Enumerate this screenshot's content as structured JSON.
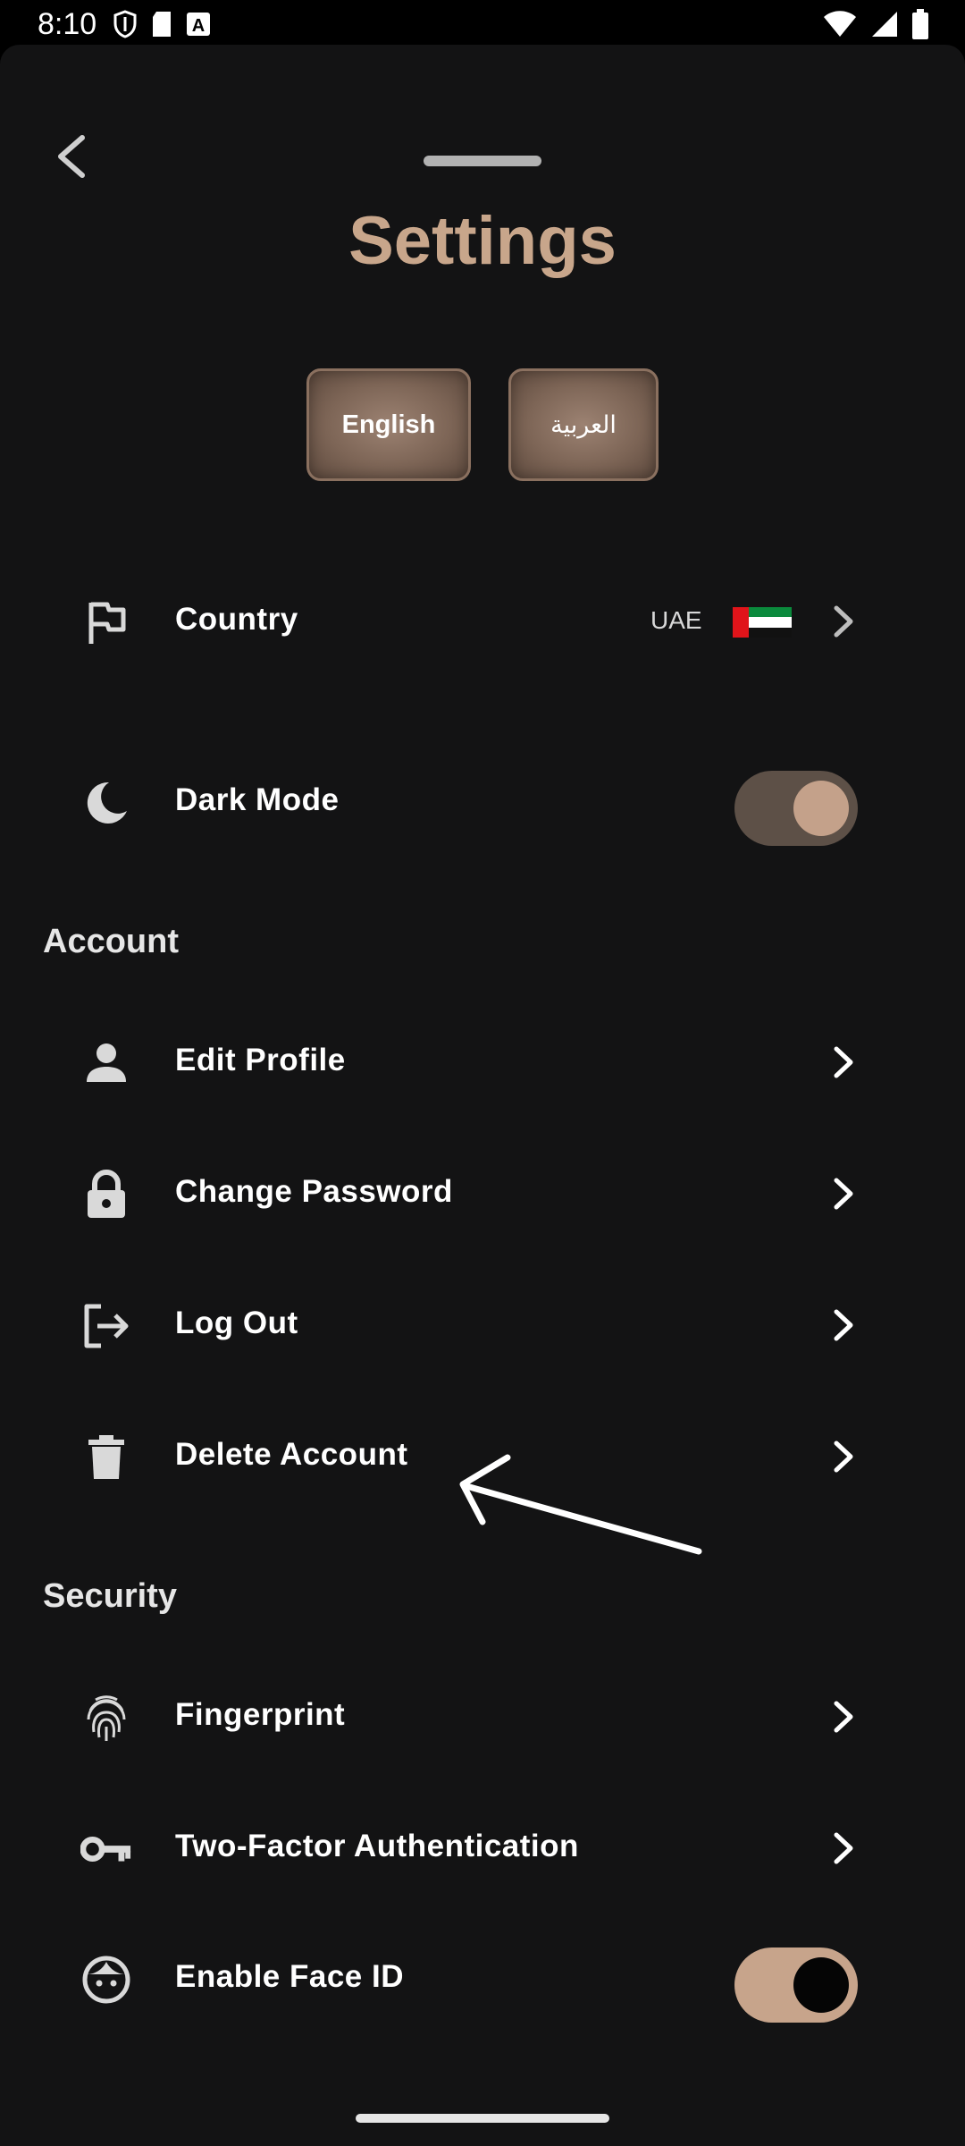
{
  "status_bar": {
    "time": "8:10"
  },
  "header": {
    "title": "Settings"
  },
  "language": {
    "english_label": "English",
    "arabic_label": "العربية"
  },
  "general": {
    "country": {
      "label": "Country",
      "value": "UAE"
    },
    "dark_mode": {
      "label": "Dark Mode",
      "enabled": true
    }
  },
  "account": {
    "header": "Account",
    "items": [
      {
        "label": "Edit Profile",
        "icon": "person-icon"
      },
      {
        "label": "Change Password",
        "icon": "lock-icon"
      },
      {
        "label": "Log Out",
        "icon": "logout-icon"
      },
      {
        "label": "Delete Account",
        "icon": "trash-icon"
      }
    ]
  },
  "security": {
    "header": "Security",
    "items": [
      {
        "label": "Fingerprint",
        "icon": "fingerprint-icon"
      },
      {
        "label": "Two-Factor Authentication",
        "icon": "key-icon"
      }
    ],
    "face_id": {
      "label": "Enable Face ID",
      "enabled": true
    }
  },
  "colors": {
    "accent": "#c8a68b",
    "background": "#131314",
    "toggle_track_dark": "#5d5047"
  }
}
